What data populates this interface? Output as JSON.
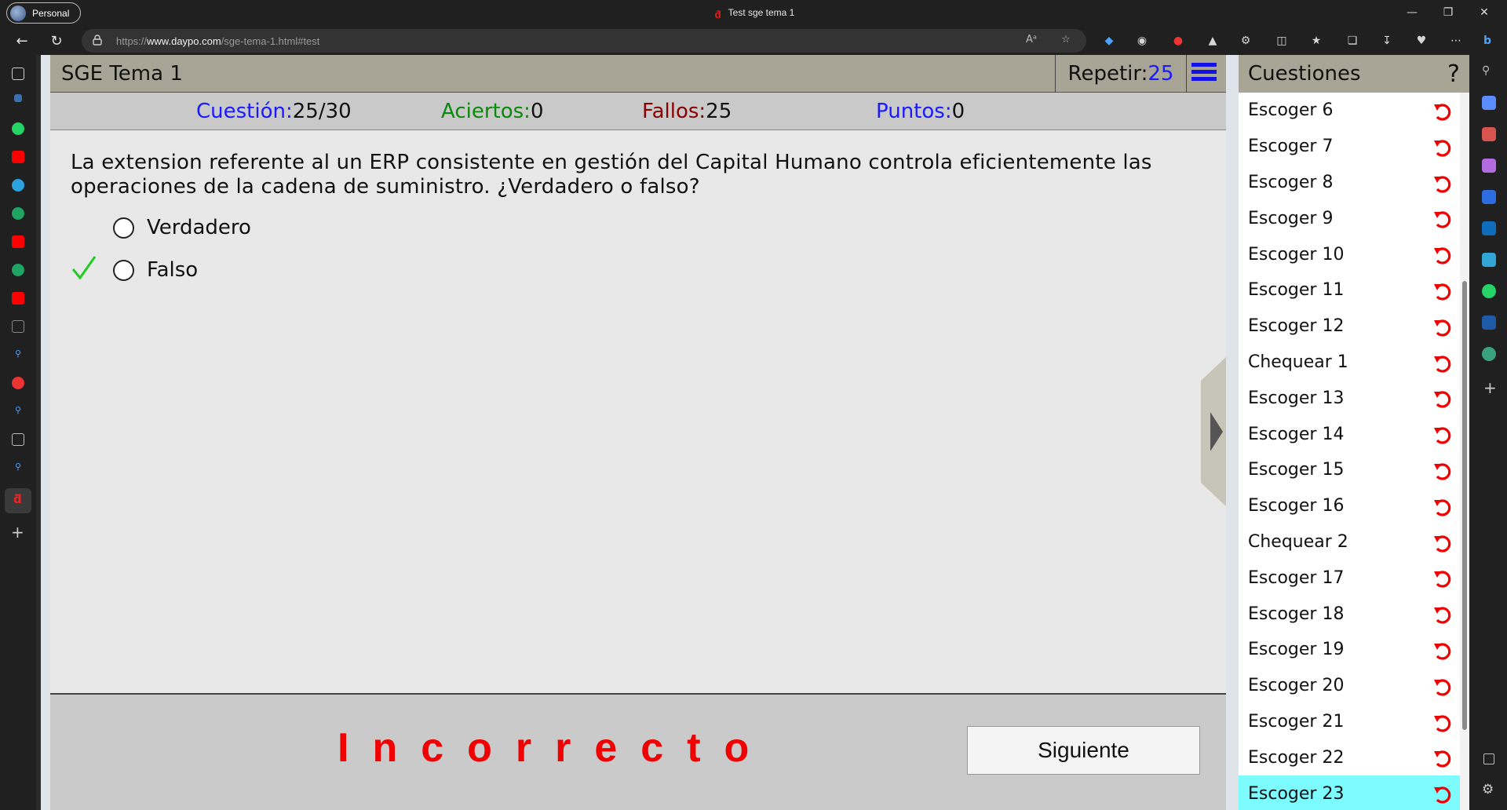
{
  "browser": {
    "profile_label": "Personal",
    "window_title": "Test sge tema 1",
    "url_prefix": "https://",
    "url_domain": "www.daypo.com",
    "url_path": "/sge-tema-1.html#test",
    "read_aloud_label": "Aᵃ"
  },
  "quiz": {
    "title": "SGE Tema 1",
    "repetir_label": "Repetir:",
    "repetir_value": "25",
    "stats": {
      "cuestion_label": "Cuestión:",
      "cuestion_value": "25/30",
      "aciertos_label": "Aciertos:",
      "aciertos_value": "0",
      "fallos_label": "Fallos:",
      "fallos_value": "25",
      "puntos_label": "Puntos:",
      "puntos_value": "0"
    },
    "question": "La extension referente al un ERP consistente en gestión del Capital Humano controla eficientemente las operaciones de la cadena de suministro. ¿Verdadero o falso?",
    "options": [
      "Verdadero",
      "Falso"
    ],
    "correct_option_index": 1,
    "result": "Incorrecto",
    "next_label": "Siguiente",
    "colors": {
      "result": "#f00000",
      "correct_mark": "#22cc22",
      "active_item": "#7dfcff"
    }
  },
  "panel": {
    "title": "Cuestiones",
    "help": "?",
    "items": [
      "Escoger 6",
      "Escoger 7",
      "Escoger 8",
      "Escoger 9",
      "Escoger 10",
      "Escoger 11",
      "Escoger 12",
      "Chequear 1",
      "Escoger 13",
      "Escoger 14",
      "Escoger 15",
      "Escoger 16",
      "Chequear 2",
      "Escoger 17",
      "Escoger 18",
      "Escoger 19",
      "Escoger 20",
      "Escoger 21",
      "Escoger 22",
      "Escoger 23"
    ],
    "active_item_index": 19
  }
}
